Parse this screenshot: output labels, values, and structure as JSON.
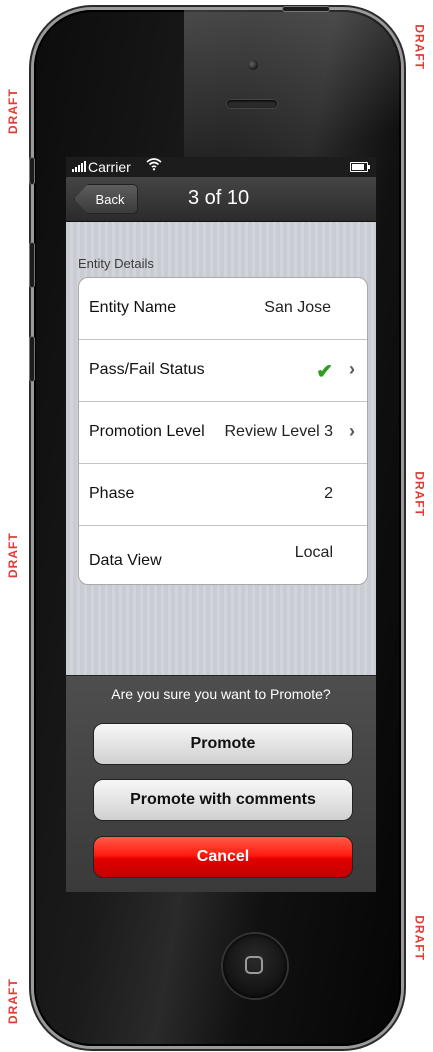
{
  "watermark": "DRAFT",
  "status_bar": {
    "carrier": "Carrier"
  },
  "nav": {
    "back_label": "Back",
    "title": "3 of 10"
  },
  "section": {
    "title": "Entity Details"
  },
  "rows": [
    {
      "label": "Entity Name",
      "value": "San Jose"
    },
    {
      "label": "Pass/Fail Status",
      "value": "",
      "status": "pass",
      "icon": "checkmark-icon"
    },
    {
      "label": "Promotion Level",
      "value": "Review Level 3"
    },
    {
      "label": "Phase",
      "value": "2"
    },
    {
      "label": "Data View",
      "value": "Local"
    }
  ],
  "action_sheet": {
    "question": "Are you sure you want to Promote?",
    "promote_label": "Promote",
    "promote_comments_label": "Promote with comments",
    "cancel_label": "Cancel"
  },
  "colors": {
    "watermark": "#e53935",
    "check": "#2e9e22",
    "cancel": "#e10000"
  }
}
